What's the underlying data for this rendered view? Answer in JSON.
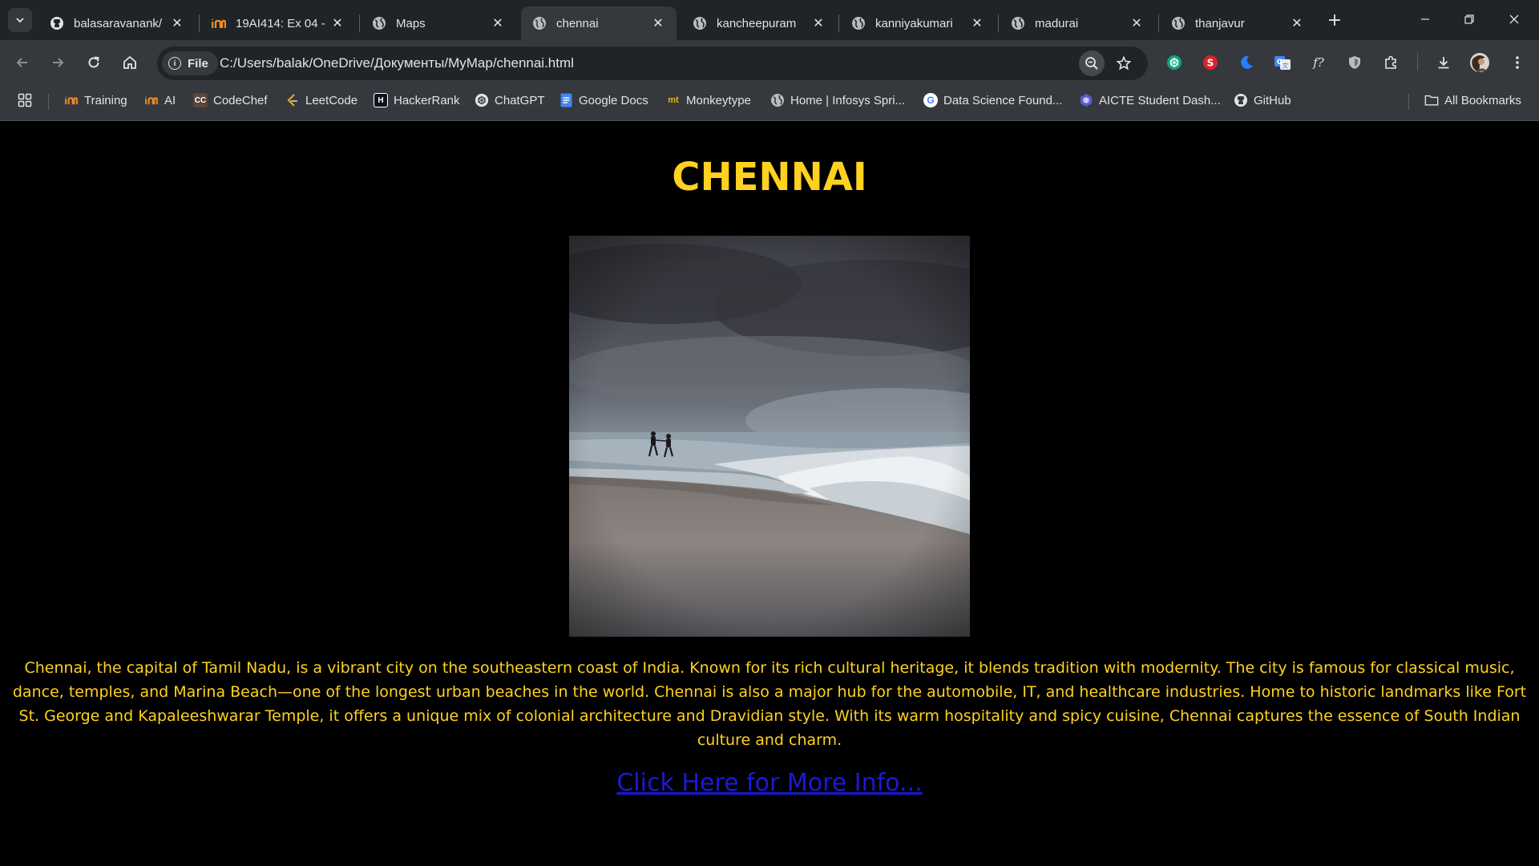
{
  "browser": {
    "tabs": [
      {
        "title": "balasaravanank/",
        "favicon": "github-icon",
        "active": false
      },
      {
        "title": "19AI414: Ex 04 -",
        "favicon": "infosys-springboard-icon",
        "active": false
      },
      {
        "title": "Maps",
        "favicon": "globe-icon",
        "active": false
      },
      {
        "title": "chennai",
        "favicon": "globe-icon",
        "active": true
      },
      {
        "title": "kancheepuram",
        "favicon": "globe-icon",
        "active": false
      },
      {
        "title": "kanniyakumari",
        "favicon": "globe-icon",
        "active": false
      },
      {
        "title": "madurai",
        "favicon": "globe-icon",
        "active": false
      },
      {
        "title": "thanjavur",
        "favicon": "globe-icon",
        "active": false
      }
    ],
    "address": {
      "chip_label": "File",
      "url": "C:/Users/balak/OneDrive/Документы/MyMap/chennai.html"
    },
    "bookmarks": [
      {
        "label": "Training",
        "icon": "infosys-springboard-icon"
      },
      {
        "label": "AI",
        "icon": "infosys-springboard-icon"
      },
      {
        "label": "CodeChef",
        "icon": "codechef-icon"
      },
      {
        "label": "LeetCode",
        "icon": "leetcode-icon"
      },
      {
        "label": "HackerRank",
        "icon": "hackerrank-icon"
      },
      {
        "label": "ChatGPT",
        "icon": "chatgpt-icon"
      },
      {
        "label": "Google Docs",
        "icon": "google-docs-icon"
      },
      {
        "label": "Monkeytype",
        "icon": "monkeytype-icon"
      },
      {
        "label": "Home | Infosys Spri...",
        "icon": "globe-icon"
      },
      {
        "label": "Data Science Found...",
        "icon": "google-icon"
      },
      {
        "label": "AICTE Student Dash...",
        "icon": "aicte-icon"
      },
      {
        "label": "GitHub",
        "icon": "github-icon"
      }
    ],
    "all_bookmarks_label": "All Bookmarks"
  },
  "page": {
    "title": "CHENNAI",
    "image_subject": "beach-with-waves-and-two-people-photo",
    "description": "Chennai, the capital of Tamil Nadu, is a vibrant city on the southeastern coast of India. Known for its rich cultural heritage, it blends tradition with modernity. The city is famous for classical music, dance, temples, and Marina Beach—one of the longest urban beaches in the world. Chennai is also a major hub for the automobile, IT, and healthcare industries. Home to historic landmarks like Fort St. George and Kapaleeshwarar Temple, it offers a unique mix of colonial architecture and Dravidian style. With its warm hospitality and spicy cuisine, Chennai captures the essence of South Indian culture and charm.",
    "link_text": "Click Here for More Info..."
  },
  "colors": {
    "page_bg": "#000000",
    "heading": "#ffd21f",
    "text": "#ffd21f",
    "link": "#1a1ad8",
    "chrome_dark": "#1f2428",
    "chrome_toolbar": "#35393d"
  }
}
